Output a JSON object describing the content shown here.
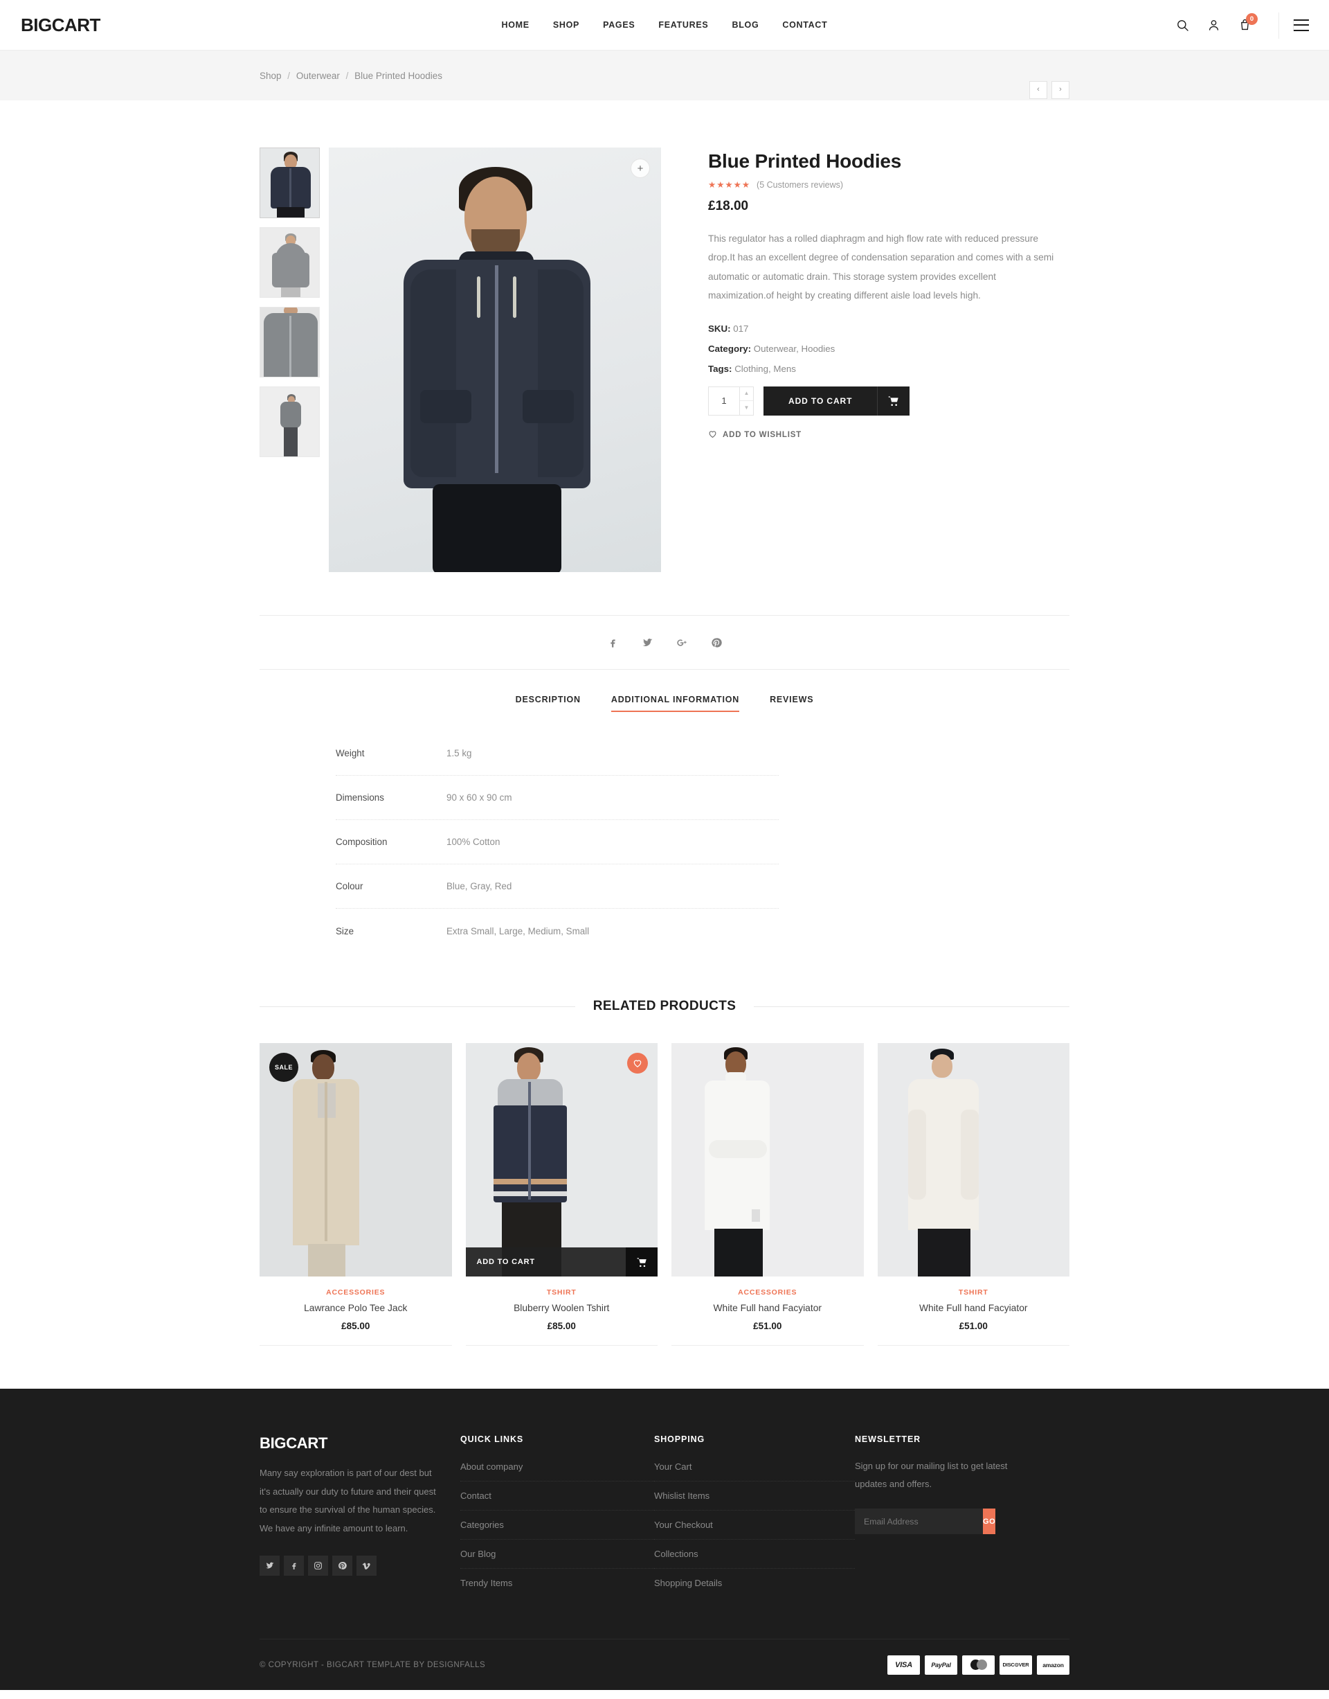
{
  "header": {
    "logo": "BIGCART",
    "nav": [
      {
        "label": "HOME"
      },
      {
        "label": "SHOP"
      },
      {
        "label": "PAGES"
      },
      {
        "label": "FEATURES"
      },
      {
        "label": "BLOG"
      },
      {
        "label": "CONTACT"
      }
    ],
    "cart_count": "0",
    "icons": [
      "search-icon",
      "user-icon",
      "cart-icon",
      "menu-icon"
    ]
  },
  "breadcrumb": {
    "items": [
      "Shop",
      "Outerwear",
      "Blue Printed Hoodies"
    ],
    "separator": "/",
    "prev": "‹",
    "next": "›"
  },
  "product": {
    "title": "Blue Printed Hoodies",
    "stars": "★★★★★",
    "rating_value": 5,
    "reviews_text": "(5 Customers reviews)",
    "price": "£18.00",
    "description": "This regulator has a rolled diaphragm and high flow rate with reduced pressure drop.It has an excellent degree of condensation separation and comes with a semi automatic or automatic drain. This storage system provides excellent maximization.of height by creating different aisle load levels high.",
    "sku_label": "SKU:",
    "sku_value": "017",
    "category_label": "Category:",
    "category_value": "Outerwear, Hoodies",
    "tags_label": "Tags:",
    "tags_value": "Clothing, Mens",
    "quantity": "1",
    "add_to_cart": "ADD TO CART",
    "wishlist": "ADD TO WISHLIST",
    "zoom_glyph": "+",
    "thumbnails": [
      {
        "alt": "navy-hoodie-front"
      },
      {
        "alt": "gray-hoodie-back"
      },
      {
        "alt": "gray-hoodie-closeup"
      },
      {
        "alt": "gray-hoodie-full-body"
      }
    ]
  },
  "share": {
    "items": [
      "facebook-icon",
      "twitter-icon",
      "google-plus-icon",
      "pinterest-icon"
    ]
  },
  "tabs": {
    "items": [
      {
        "label": "DESCRIPTION",
        "active": false
      },
      {
        "label": "ADDITIONAL INFORMATION",
        "active": true
      },
      {
        "label": "REVIEWS",
        "active": false
      }
    ]
  },
  "attributes": [
    {
      "key": "Weight",
      "value": "1.5 kg"
    },
    {
      "key": "Dimensions",
      "value": "90 x 60 x 90 cm"
    },
    {
      "key": "Composition",
      "value": "100% Cotton"
    },
    {
      "key": "Colour",
      "value": "Blue, Gray, Red"
    },
    {
      "key": "Size",
      "value": "Extra Small, Large, Medium, Small"
    }
  ],
  "related": {
    "title": "RELATED PRODUCTS",
    "add_to_cart": "ADD TO CART",
    "sale_badge": "SALE",
    "products": [
      {
        "category": "ACCESSORIES",
        "name": "Lawrance Polo Tee Jack",
        "price": "£85.00",
        "badge": "SALE",
        "show_cart": false,
        "show_fav": false
      },
      {
        "category": "TSHIRT",
        "name": "Bluberry Woolen Tshirt",
        "price": "£85.00",
        "badge": "",
        "show_cart": true,
        "show_fav": true
      },
      {
        "category": "ACCESSORIES",
        "name": "White Full hand Facyiator",
        "price": "£51.00",
        "badge": "",
        "show_cart": false,
        "show_fav": false
      },
      {
        "category": "TSHIRT",
        "name": "White Full hand Facyiator",
        "price": "£51.00",
        "badge": "",
        "show_cart": false,
        "show_fav": false
      }
    ]
  },
  "footer": {
    "logo": "BIGCART",
    "about": "Many say exploration is part of our dest but it's actually our duty to future and their quest to ensure the survival of the human species. We have any infinite amount to learn.",
    "social": [
      "twitter-icon",
      "facebook-icon",
      "instagram-icon",
      "pinterest-icon",
      "vimeo-icon"
    ],
    "quick_links_title": "QUICK LINKS",
    "quick_links": [
      {
        "label": "About company"
      },
      {
        "label": "Contact"
      },
      {
        "label": "Categories"
      },
      {
        "label": "Our Blog"
      },
      {
        "label": "Trendy Items"
      }
    ],
    "shopping_title": "SHOPPING",
    "shopping": [
      {
        "label": "Your Cart"
      },
      {
        "label": "Whislist Items"
      },
      {
        "label": "Your Checkout"
      },
      {
        "label": "Collections"
      },
      {
        "label": "Shopping Details"
      }
    ],
    "newsletter_title": "NEWSLETTER",
    "newsletter_text": "Sign up for our mailing list to get latest updates and offers.",
    "email_placeholder": "Email Address",
    "email_value": "",
    "go_label": "GO",
    "copyright": "© COPYRIGHT - BIGCART TEMPLATE BY DESIGNFALLS",
    "payments": [
      {
        "label": "VISA"
      },
      {
        "label": "PayPal"
      },
      {
        "label": "MasterCard"
      },
      {
        "label": "DISC⊙VER"
      },
      {
        "label": "amazon"
      }
    ]
  },
  "colors": {
    "accent": "#ee7455",
    "dark": "#1d1d1d",
    "muted": "#8b8b8b",
    "footer_bg": "#1d1d1d"
  }
}
